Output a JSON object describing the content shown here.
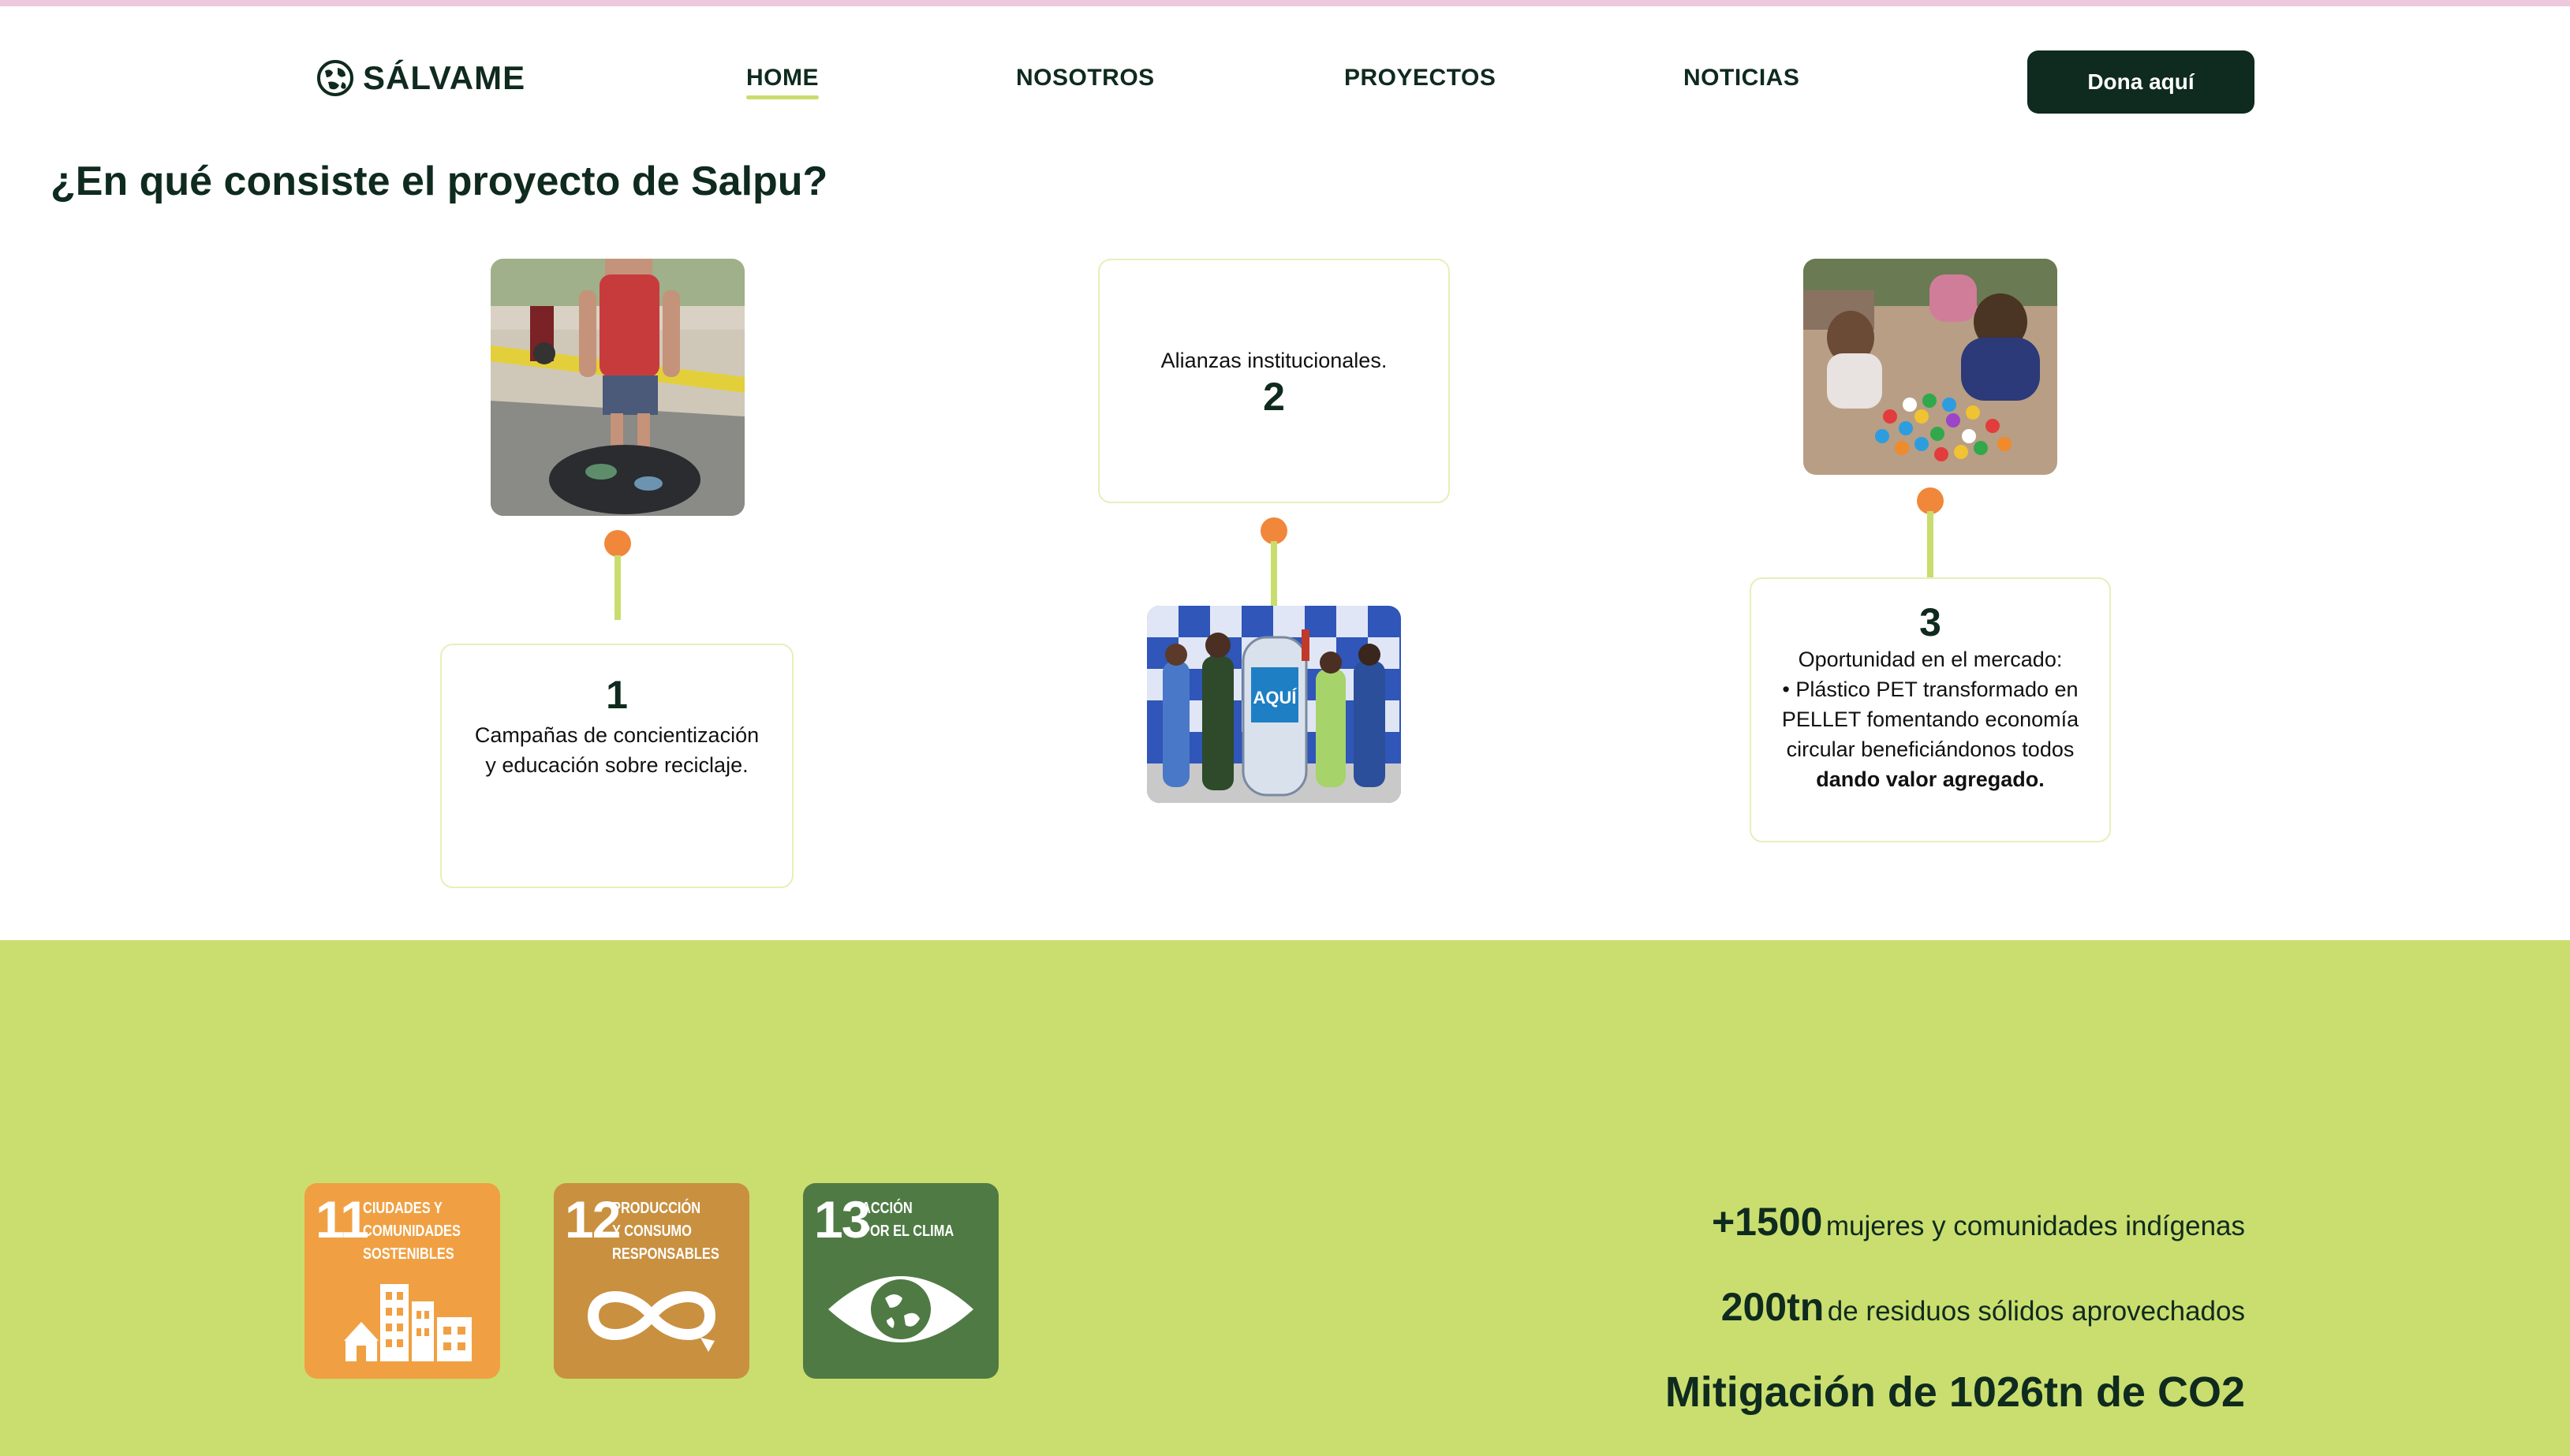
{
  "brand": {
    "name": "SÁLVAME",
    "logo_icon": "globe-hands-icon"
  },
  "nav": {
    "items": [
      {
        "label": "HOME",
        "active": true
      },
      {
        "label": "NOSOTROS",
        "active": false
      },
      {
        "label": "PROYECTOS",
        "active": false
      },
      {
        "label": "NOTICIAS",
        "active": false
      }
    ],
    "donate_label": "Dona aquí"
  },
  "section": {
    "title": "¿En qué consiste el proyecto de Salpu?"
  },
  "steps": [
    {
      "number": "1",
      "text": "Campañas de concientización y educación sobre reciclaje.",
      "photo": "woman-with-bottles-photo"
    },
    {
      "number": "2",
      "text": "Alianzas institucionales.",
      "photo": "team-with-collection-bin-photo",
      "bin_label": "AQUÍ"
    },
    {
      "number": "3",
      "text_line1": "Oportunidad en el mercado:",
      "text_line2": "• Plástico PET transformado en PELLET fomentando economía circular beneficiándonos todos",
      "text_bold": "dando valor agregado.",
      "photo": "people-sorting-plastic-caps-photo"
    }
  ],
  "sdgs": [
    {
      "number": "11",
      "label_lines": [
        "CIUDADES Y",
        "COMUNIDADES",
        "SOSTENIBLES"
      ],
      "color": "#f0a043",
      "icon": "city-buildings-icon"
    },
    {
      "number": "12",
      "label_lines": [
        "PRODUCCIÓN",
        "Y CONSUMO",
        "RESPONSABLES"
      ],
      "color": "#c99040",
      "icon": "infinity-loop-icon"
    },
    {
      "number": "13",
      "label_lines": [
        "ACCIÓN",
        "POR EL CLIMA"
      ],
      "color": "#4f7a44",
      "icon": "eye-globe-icon"
    }
  ],
  "stats": [
    {
      "value": "+1500",
      "label": "mujeres y comunidades indígenas"
    },
    {
      "value": "200tn",
      "label": "de residuos sólidos aprovechados"
    },
    {
      "value": "Mitigación de 1026tn de CO2",
      "label": ""
    }
  ],
  "colors": {
    "dark": "#0f2a1e",
    "lime": "#c9de6e",
    "orange_dot": "#f0873a",
    "topline": "#ecc9dc"
  }
}
